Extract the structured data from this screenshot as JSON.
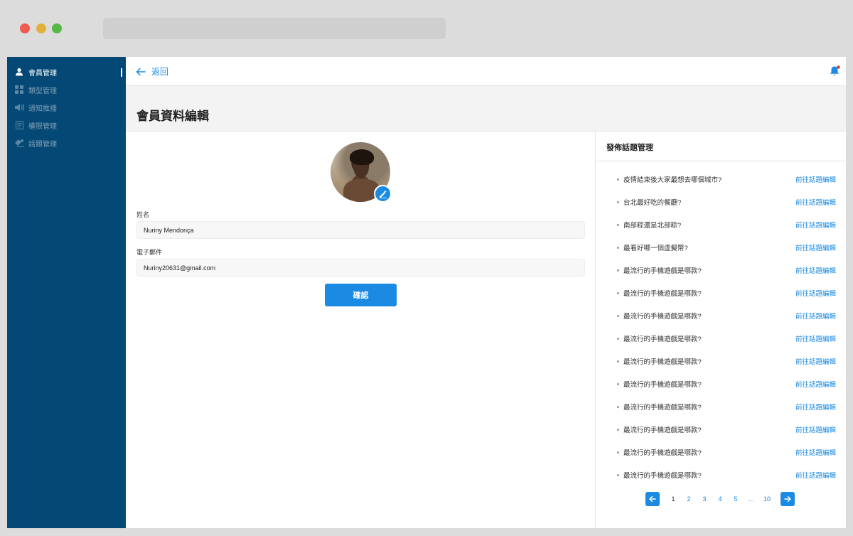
{
  "sidebar": {
    "items": [
      {
        "label": "會員管理",
        "icon": "user-icon",
        "active": true
      },
      {
        "label": "類型管理",
        "icon": "grid-icon",
        "active": false
      },
      {
        "label": "通知推播",
        "icon": "speaker-icon",
        "active": false
      },
      {
        "label": "權限管理",
        "icon": "document-icon",
        "active": false
      },
      {
        "label": "話題管理",
        "icon": "chat-icon",
        "active": false
      }
    ]
  },
  "topbar": {
    "back_label": "返回",
    "back_icon": "arrow-left-icon",
    "bell_icon": "bell-icon"
  },
  "page": {
    "title": "會員資料編輯"
  },
  "form": {
    "avatar_edit_icon": "pencil-icon",
    "name_label": "姓名",
    "name_value": "Nuriny Mendonça",
    "email_label": "電子郵件",
    "email_value": "Nuriny20631@gmail.com",
    "confirm_label": "確認"
  },
  "topics": {
    "title": "發佈話題管理",
    "link_label": "前往話題編輯",
    "items": [
      "疫情結束後大家最想去哪個城市?",
      "台北最好吃的餐廳?",
      "南部粽還是北部粽?",
      "最看好哪一個虛擬幣?",
      "最流行的手機遊戲是哪款?",
      "最流行的手機遊戲是哪款?",
      "最流行的手機遊戲是哪款?",
      "最流行的手機遊戲是哪款?",
      "最流行的手機遊戲是哪款?",
      "最流行的手機遊戲是哪款?",
      "最流行的手機遊戲是哪款?",
      "最流行的手機遊戲是哪款?",
      "最流行的手機遊戲是哪款?",
      "最流行的手機遊戲是哪款?"
    ]
  },
  "pagination": {
    "pages": [
      "1",
      "2",
      "3",
      "4",
      "5",
      "...",
      "10"
    ],
    "current": "1",
    "prev_icon": "arrow-left-icon",
    "next_icon": "arrow-right-icon"
  },
  "colors": {
    "sidebar": "#044876",
    "accent": "#1a8ae2",
    "notification_dot": "#e53935"
  }
}
